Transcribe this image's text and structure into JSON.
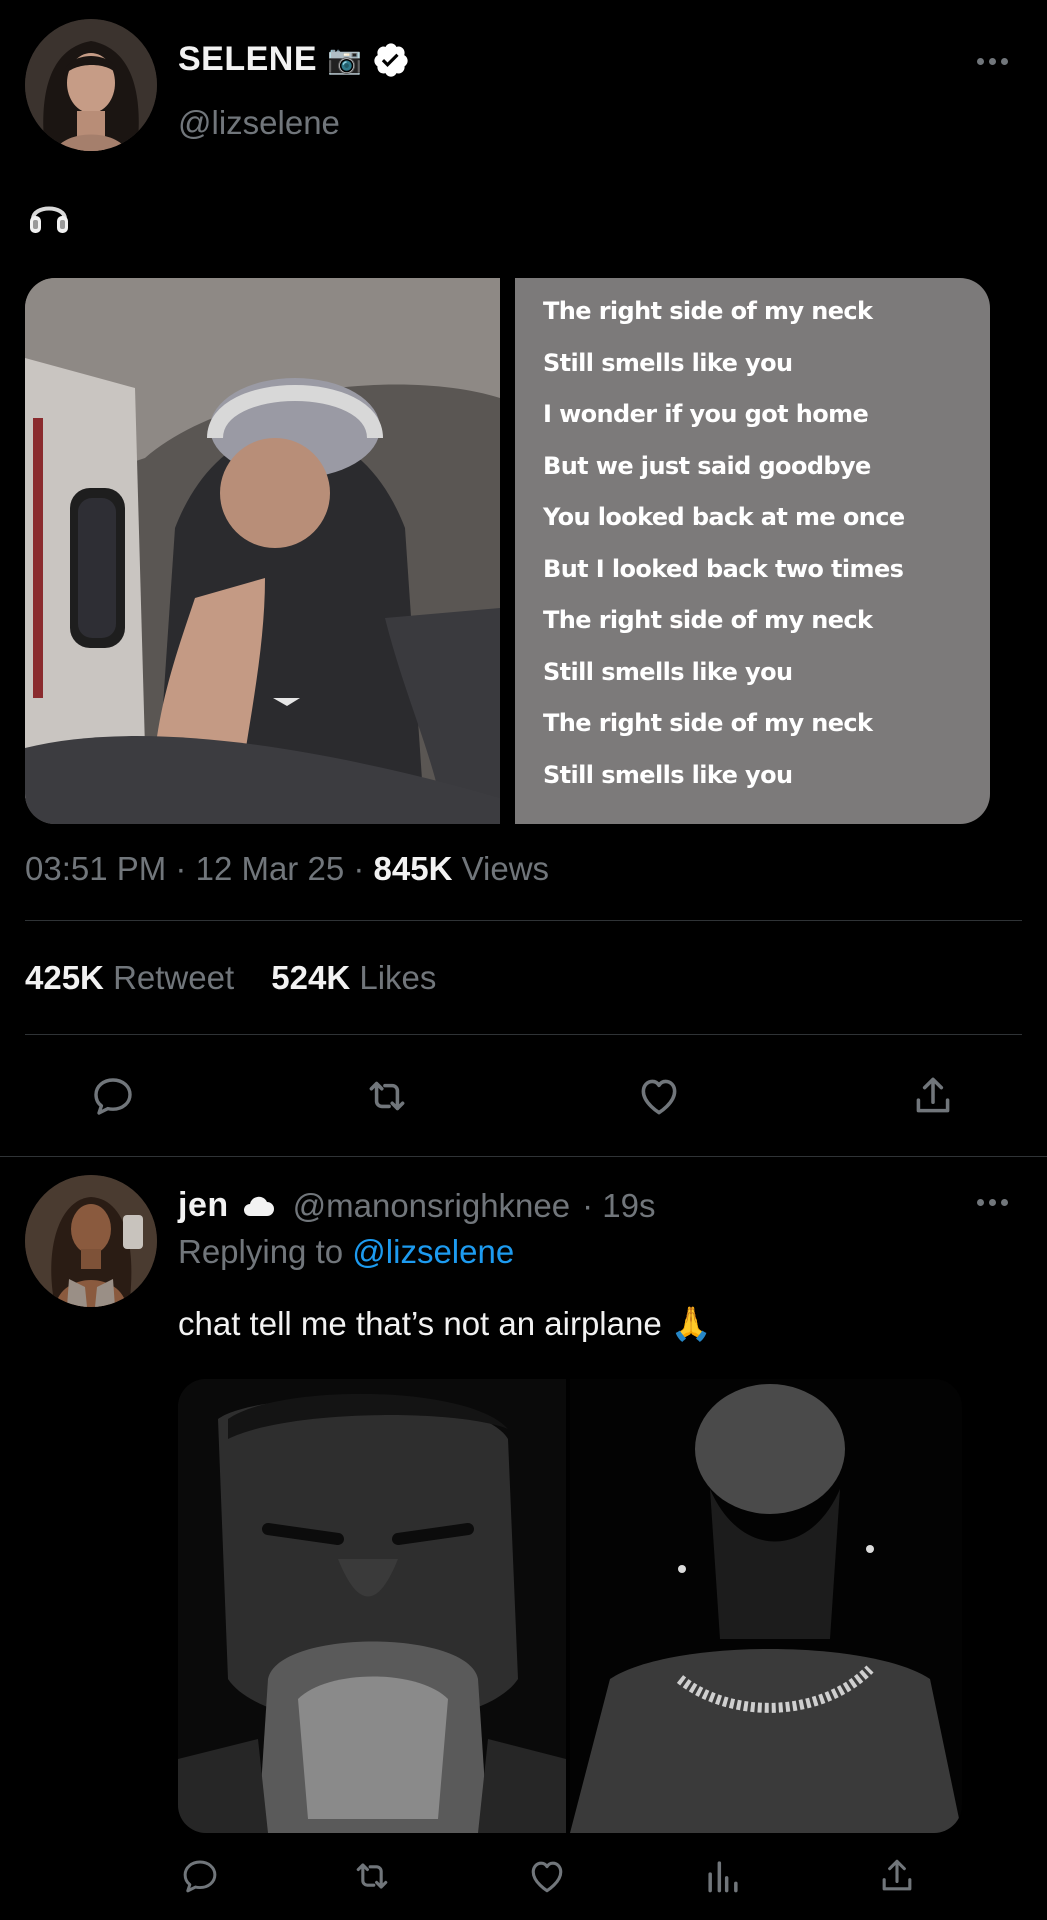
{
  "tweet": {
    "author_name": "SELENE",
    "author_handle": "@lizselene",
    "name_emoji": "📷",
    "body_icon": "headphones-icon",
    "lyrics": [
      "The right side of my neck",
      "Still smells like you",
      "I wonder if you got home",
      "But we just said goodbye",
      "You looked back at me once",
      "But I looked back two times",
      "The right side of my neck",
      "Still smells like you",
      "The right side of my neck",
      "Still smells like you"
    ],
    "time": "03:51 PM",
    "date": "12 Mar 25",
    "separator": "·",
    "views_count": "845K",
    "views_label": "Views",
    "retweets_count": "425K",
    "retweets_label": "Retweet",
    "likes_count": "524K",
    "likes_label": "Likes"
  },
  "reply": {
    "author_name": "jen",
    "author_handle": "@manonsrighknee",
    "time_ago": "· 19s",
    "replying_label": "Replying to",
    "replying_handle": "@lizselene",
    "text": "chat tell me that’s not an airplane",
    "text_emoji": "🙏"
  },
  "colors": {
    "background": "#000000",
    "text": "#e7e9ea",
    "muted": "#71767b",
    "link": "#1d9bf0",
    "divider": "#2f3336",
    "lyrics_card": "#7c7a7a"
  }
}
